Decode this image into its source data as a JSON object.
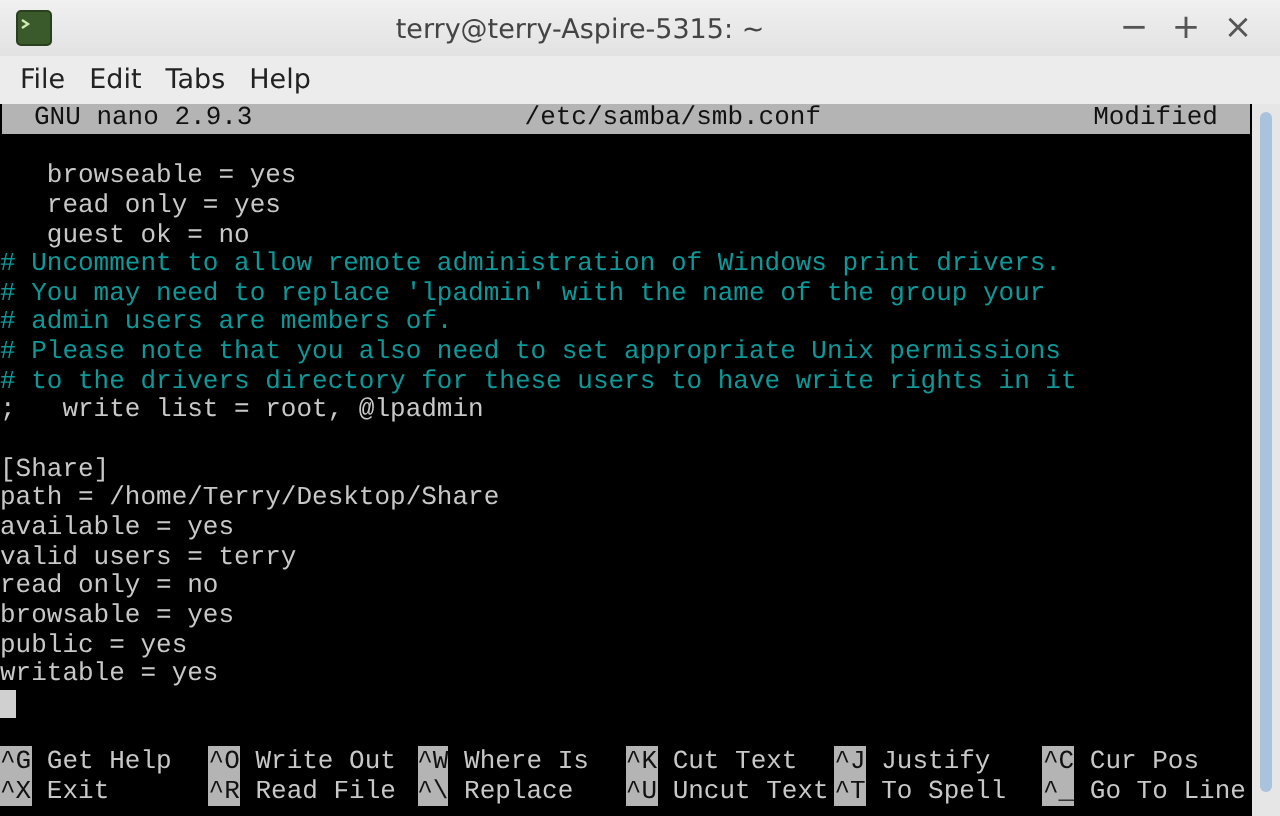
{
  "window": {
    "title": "terry@terry-Aspire-5315: ~",
    "controls": [
      "−",
      "+",
      "×"
    ]
  },
  "menu": [
    "File",
    "Edit",
    "Tabs",
    "Help"
  ],
  "nano_header": {
    "version": "GNU nano 2.9.3",
    "filename": "/etc/samba/smb.conf",
    "status": "Modified"
  },
  "lines": [
    {
      "kind": "blank"
    },
    {
      "kind": "plain",
      "text": "   browseable = yes"
    },
    {
      "kind": "plain",
      "text": "   read only = yes"
    },
    {
      "kind": "plain",
      "text": "   guest ok = no"
    },
    {
      "kind": "comment",
      "text": "# Uncomment to allow remote administration of Windows print drivers."
    },
    {
      "kind": "comment",
      "text": "# You may need to replace 'lpadmin' with the name of the group your"
    },
    {
      "kind": "comment",
      "text": "# admin users are members of."
    },
    {
      "kind": "comment",
      "text": "# Please note that you also need to set appropriate Unix permissions"
    },
    {
      "kind": "comment",
      "text": "# to the drivers directory for these users to have write rights in it"
    },
    {
      "kind": "plain",
      "text": ";   write list = root, @lpadmin"
    },
    {
      "kind": "blank"
    },
    {
      "kind": "plain",
      "text": "[Share]"
    },
    {
      "kind": "plain",
      "text": "path = /home/Terry/Desktop/Share"
    },
    {
      "kind": "plain",
      "text": "available = yes"
    },
    {
      "kind": "plain",
      "text": "valid users = terry"
    },
    {
      "kind": "plain",
      "text": "read only = no"
    },
    {
      "kind": "plain",
      "text": "browsable = yes"
    },
    {
      "kind": "plain",
      "text": "public = yes"
    },
    {
      "kind": "plain",
      "text": "writable = yes"
    },
    {
      "kind": "cursor"
    },
    {
      "kind": "blank"
    }
  ],
  "shortcuts": [
    {
      "key": "^G",
      "label": "Get Help"
    },
    {
      "key": "^O",
      "label": "Write Out"
    },
    {
      "key": "^W",
      "label": "Where Is"
    },
    {
      "key": "^K",
      "label": "Cut Text"
    },
    {
      "key": "^J",
      "label": "Justify"
    },
    {
      "key": "^C",
      "label": "Cur Pos"
    },
    {
      "key": "^X",
      "label": "Exit"
    },
    {
      "key": "^R",
      "label": "Read File"
    },
    {
      "key": "^\\",
      "label": "Replace"
    },
    {
      "key": "^U",
      "label": "Uncut Text"
    },
    {
      "key": "^T",
      "label": "To Spell"
    },
    {
      "key": "^_",
      "label": "Go To Line"
    }
  ]
}
